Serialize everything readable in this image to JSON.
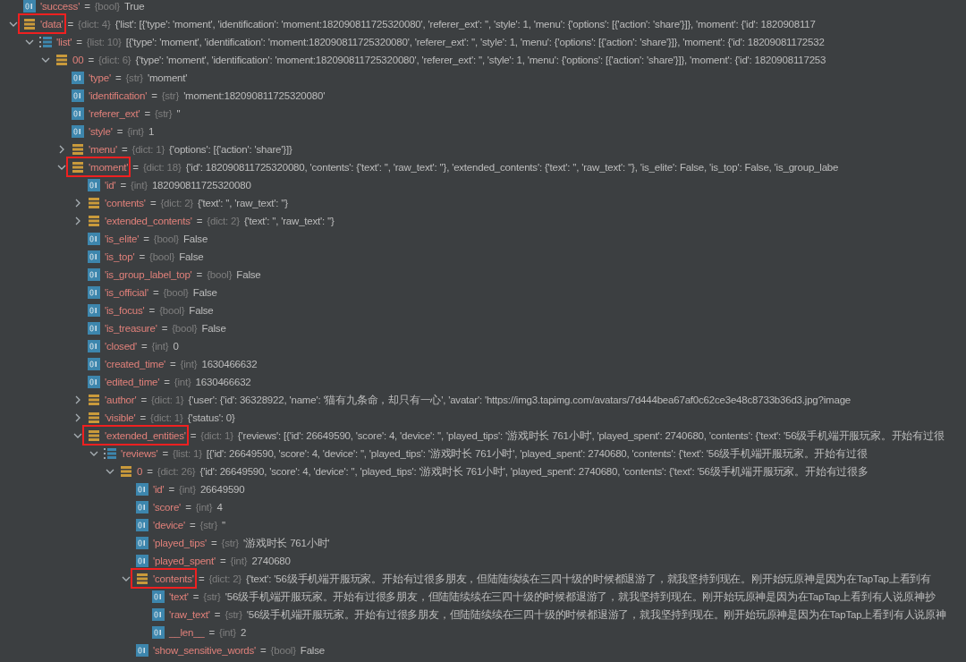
{
  "tree": [
    {
      "kind": "field",
      "key": "'success'",
      "eq": "=",
      "type": "{bool}",
      "value": "True",
      "highlighted": false
    },
    {
      "kind": "dict",
      "key": "'data'",
      "eq": "=",
      "type": "{dict: 4}",
      "value": "{'list': [{'type': 'moment', 'identification': 'moment:182090811725320080', 'referer_ext': '', 'style': 1, 'menu': {'options': [{'action': 'share'}]}, 'moment': {'id': 1820908117",
      "expanded": true,
      "highlighted": true,
      "children": [
        {
          "kind": "list",
          "key": "'list'",
          "eq": "=",
          "type": "{list: 10}",
          "value": "[{'type': 'moment', 'identification': 'moment:182090811725320080', 'referer_ext': '', 'style': 1, 'menu': {'options': [{'action': 'share'}]}, 'moment': {'id': 18209081172532",
          "expanded": true,
          "highlighted": false,
          "children": [
            {
              "kind": "dict",
              "key": "00",
              "eq": "=",
              "type": "{dict: 6}",
              "value": "{'type': 'moment', 'identification': 'moment:182090811725320080', 'referer_ext': '', 'style': 1, 'menu': {'options': [{'action': 'share'}]}, 'moment': {'id': 1820908117253",
              "expanded": true,
              "highlighted": false,
              "children": [
                {
                  "kind": "field",
                  "key": "'type'",
                  "eq": "=",
                  "type": "{str}",
                  "value": "'moment'",
                  "highlighted": false
                },
                {
                  "kind": "field",
                  "key": "'identification'",
                  "eq": "=",
                  "type": "{str}",
                  "value": "'moment:182090811725320080'",
                  "highlighted": false
                },
                {
                  "kind": "field",
                  "key": "'referer_ext'",
                  "eq": "=",
                  "type": "{str}",
                  "value": "''",
                  "highlighted": false
                },
                {
                  "kind": "field",
                  "key": "'style'",
                  "eq": "=",
                  "type": "{int}",
                  "value": "1",
                  "highlighted": false
                },
                {
                  "kind": "dict",
                  "key": "'menu'",
                  "eq": "=",
                  "type": "{dict: 1}",
                  "value": "{'options': [{'action': 'share'}]}",
                  "expanded": false,
                  "highlighted": false
                },
                {
                  "kind": "dict",
                  "key": "'moment'",
                  "eq": "=",
                  "type": "{dict: 18}",
                  "value": "{'id': 182090811725320080, 'contents': {'text': '', 'raw_text': ''}, 'extended_contents': {'text': '', 'raw_text': ''}, 'is_elite': False, 'is_top': False, 'is_group_labe",
                  "expanded": true,
                  "highlighted": true,
                  "children": [
                    {
                      "kind": "field",
                      "key": "'id'",
                      "eq": "=",
                      "type": "{int}",
                      "value": "182090811725320080",
                      "highlighted": false
                    },
                    {
                      "kind": "dict",
                      "key": "'contents'",
                      "eq": "=",
                      "type": "{dict: 2}",
                      "value": "{'text': '', 'raw_text': ''}",
                      "expanded": false,
                      "highlighted": false
                    },
                    {
                      "kind": "dict",
                      "key": "'extended_contents'",
                      "eq": "=",
                      "type": "{dict: 2}",
                      "value": "{'text': '', 'raw_text': ''}",
                      "expanded": false,
                      "highlighted": false
                    },
                    {
                      "kind": "field",
                      "key": "'is_elite'",
                      "eq": "=",
                      "type": "{bool}",
                      "value": "False",
                      "highlighted": false
                    },
                    {
                      "kind": "field",
                      "key": "'is_top'",
                      "eq": "=",
                      "type": "{bool}",
                      "value": "False",
                      "highlighted": false
                    },
                    {
                      "kind": "field",
                      "key": "'is_group_label_top'",
                      "eq": "=",
                      "type": "{bool}",
                      "value": "False",
                      "highlighted": false
                    },
                    {
                      "kind": "field",
                      "key": "'is_official'",
                      "eq": "=",
                      "type": "{bool}",
                      "value": "False",
                      "highlighted": false
                    },
                    {
                      "kind": "field",
                      "key": "'is_focus'",
                      "eq": "=",
                      "type": "{bool}",
                      "value": "False",
                      "highlighted": false
                    },
                    {
                      "kind": "field",
                      "key": "'is_treasure'",
                      "eq": "=",
                      "type": "{bool}",
                      "value": "False",
                      "highlighted": false
                    },
                    {
                      "kind": "field",
                      "key": "'closed'",
                      "eq": "=",
                      "type": "{int}",
                      "value": "0",
                      "highlighted": false
                    },
                    {
                      "kind": "field",
                      "key": "'created_time'",
                      "eq": "=",
                      "type": "{int}",
                      "value": "1630466632",
                      "highlighted": false
                    },
                    {
                      "kind": "field",
                      "key": "'edited_time'",
                      "eq": "=",
                      "type": "{int}",
                      "value": "1630466632",
                      "highlighted": false
                    },
                    {
                      "kind": "dict",
                      "key": "'author'",
                      "eq": "=",
                      "type": "{dict: 1}",
                      "value": "{'user': {'id': 36328922, 'name': '猫有九条命，却只有一心', 'avatar': 'https://img3.tapimg.com/avatars/7d444bea67af0c62ce3e48c8733b36d3.jpg?image",
                      "expanded": false,
                      "highlighted": false
                    },
                    {
                      "kind": "dict",
                      "key": "'visible'",
                      "eq": "=",
                      "type": "{dict: 1}",
                      "value": "{'status': 0}",
                      "expanded": false,
                      "highlighted": false
                    },
                    {
                      "kind": "dict",
                      "key": "'extended_entities'",
                      "eq": "=",
                      "type": "{dict: 1}",
                      "value": "{'reviews': [{'id': 26649590, 'score': 4, 'device': '', 'played_tips': '游戏时长 761小时', 'played_spent': 2740680, 'contents': {'text': '56级手机端开服玩家。开始有过很",
                      "expanded": true,
                      "highlighted": true,
                      "children": [
                        {
                          "kind": "list",
                          "key": "'reviews'",
                          "eq": "=",
                          "type": "{list: 1}",
                          "value": "[{'id': 26649590, 'score': 4, 'device': '', 'played_tips': '游戏时长 761小时', 'played_spent': 2740680, 'contents': {'text': '56级手机端开服玩家。开始有过很",
                          "expanded": true,
                          "highlighted": false,
                          "children": [
                            {
                              "kind": "dict",
                              "key": "0",
                              "eq": "=",
                              "type": "{dict: 26}",
                              "value": "{'id': 26649590, 'score': 4, 'device': '', 'played_tips': '游戏时长 761小时', 'played_spent': 2740680, 'contents': {'text': '56级手机端开服玩家。开始有过很多",
                              "expanded": true,
                              "highlighted": false,
                              "children": [
                                {
                                  "kind": "field",
                                  "key": "'id'",
                                  "eq": "=",
                                  "type": "{int}",
                                  "value": "26649590",
                                  "highlighted": false
                                },
                                {
                                  "kind": "field",
                                  "key": "'score'",
                                  "eq": "=",
                                  "type": "{int}",
                                  "value": "4",
                                  "highlighted": false
                                },
                                {
                                  "kind": "field",
                                  "key": "'device'",
                                  "eq": "=",
                                  "type": "{str}",
                                  "value": "''",
                                  "highlighted": false
                                },
                                {
                                  "kind": "field",
                                  "key": "'played_tips'",
                                  "eq": "=",
                                  "type": "{str}",
                                  "value": "'游戏时长 761小时'",
                                  "highlighted": false
                                },
                                {
                                  "kind": "field",
                                  "key": "'played_spent'",
                                  "eq": "=",
                                  "type": "{int}",
                                  "value": "2740680",
                                  "highlighted": false
                                },
                                {
                                  "kind": "dict",
                                  "key": "'contents'",
                                  "eq": "=",
                                  "type": "{dict: 2}",
                                  "value": "{'text': '56级手机端开服玩家。开始有过很多朋友，但陆陆续续在三四十级的时候都退游了，就我坚持到现在。刚开始玩原神是因为在TapTap上看到有",
                                  "expanded": true,
                                  "highlighted": true,
                                  "children": [
                                    {
                                      "kind": "field",
                                      "key": "'text'",
                                      "eq": "=",
                                      "type": "{str}",
                                      "value": "'56级手机端开服玩家。开始有过很多朋友，但陆陆续续在三四十级的时候都退游了，就我坚持到现在。刚开始玩原神是因为在TapTap上看到有人说原神抄",
                                      "highlighted": false
                                    },
                                    {
                                      "kind": "field",
                                      "key": "'raw_text'",
                                      "eq": "=",
                                      "type": "{str}",
                                      "value": "'56级手机端开服玩家。开始有过很多朋友，但陆陆续续在三四十级的时候都退游了，就我坚持到现在。刚开始玩原神是因为在TapTap上看到有人说原神",
                                      "highlighted": false
                                    },
                                    {
                                      "kind": "field",
                                      "key": "__len__",
                                      "eq": "=",
                                      "type": "{int}",
                                      "value": "2",
                                      "highlighted": false
                                    }
                                  ]
                                },
                                {
                                  "kind": "field",
                                  "key": "'show_sensitive_words'",
                                  "eq": "=",
                                  "type": "{bool}",
                                  "value": "False",
                                  "highlighted": false
                                }
                              ]
                            }
                          ]
                        }
                      ]
                    }
                  ]
                }
              ]
            }
          ]
        }
      ]
    }
  ]
}
